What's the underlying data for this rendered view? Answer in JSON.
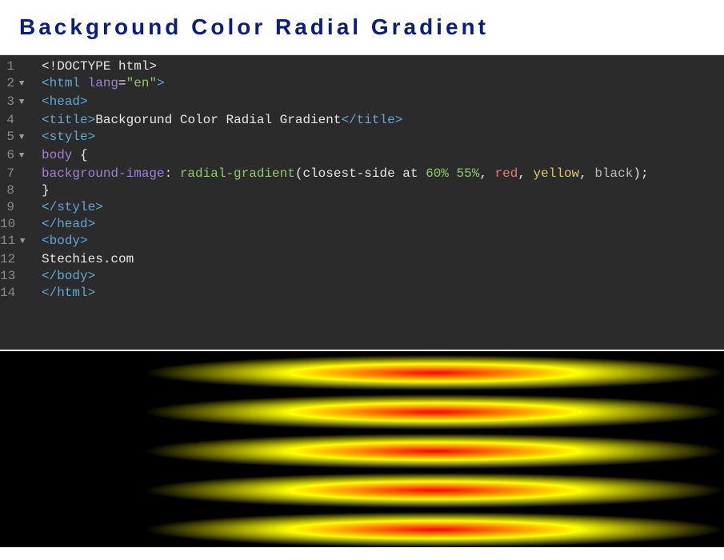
{
  "header": {
    "title": "Background Color Radial Gradient"
  },
  "code": {
    "lines": [
      {
        "n": "1",
        "fold": "",
        "segments": [
          {
            "cls": "t-default",
            "text": "<!DOCTYPE html>"
          }
        ]
      },
      {
        "n": "2",
        "fold": "▼",
        "segments": [
          {
            "cls": "t-angle",
            "text": "<"
          },
          {
            "cls": "t-tag",
            "text": "html"
          },
          {
            "cls": "t-default",
            "text": " "
          },
          {
            "cls": "t-attrname",
            "text": "lang"
          },
          {
            "cls": "t-eq",
            "text": "="
          },
          {
            "cls": "t-string",
            "text": "\"en\""
          },
          {
            "cls": "t-angle",
            "text": ">"
          }
        ]
      },
      {
        "n": "3",
        "fold": "▼",
        "segments": [
          {
            "cls": "t-angle",
            "text": "<"
          },
          {
            "cls": "t-tag",
            "text": "head"
          },
          {
            "cls": "t-angle",
            "text": ">"
          }
        ]
      },
      {
        "n": "4",
        "fold": "",
        "segments": [
          {
            "cls": "t-angle",
            "text": "<"
          },
          {
            "cls": "t-tag",
            "text": "title"
          },
          {
            "cls": "t-angle",
            "text": ">"
          },
          {
            "cls": "t-default",
            "text": "Backgorund Color Radial Gradient"
          },
          {
            "cls": "t-angle",
            "text": "</"
          },
          {
            "cls": "t-tag",
            "text": "title"
          },
          {
            "cls": "t-angle",
            "text": ">"
          }
        ]
      },
      {
        "n": "5",
        "fold": "▼",
        "segments": [
          {
            "cls": "t-angle",
            "text": "<"
          },
          {
            "cls": "t-tag",
            "text": "style"
          },
          {
            "cls": "t-angle",
            "text": ">"
          }
        ]
      },
      {
        "n": "6",
        "fold": "▼",
        "segments": [
          {
            "cls": "t-attrname",
            "text": "body"
          },
          {
            "cls": "t-default",
            "text": " "
          },
          {
            "cls": "t-brace",
            "text": "{"
          }
        ]
      },
      {
        "n": "7",
        "fold": "",
        "segments": [
          {
            "cls": "t-prop",
            "text": "background-image"
          },
          {
            "cls": "t-colon",
            "text": ": "
          },
          {
            "cls": "t-func",
            "text": "radial-gradient"
          },
          {
            "cls": "t-paren",
            "text": "("
          },
          {
            "cls": "t-ident",
            "text": "closest-side at "
          },
          {
            "cls": "t-num",
            "text": "60% 55%"
          },
          {
            "cls": "t-default",
            "text": ", "
          },
          {
            "cls": "t-kw-red",
            "text": "red"
          },
          {
            "cls": "t-default",
            "text": ", "
          },
          {
            "cls": "t-kw-yellow",
            "text": "yellow"
          },
          {
            "cls": "t-default",
            "text": ", "
          },
          {
            "cls": "t-kw-black",
            "text": "black"
          },
          {
            "cls": "t-paren",
            "text": ")"
          },
          {
            "cls": "t-default",
            "text": ";"
          }
        ]
      },
      {
        "n": "8",
        "fold": "",
        "segments": [
          {
            "cls": "t-brace",
            "text": "}"
          }
        ]
      },
      {
        "n": "9",
        "fold": "",
        "segments": [
          {
            "cls": "t-angle",
            "text": "</"
          },
          {
            "cls": "t-tag",
            "text": "style"
          },
          {
            "cls": "t-angle",
            "text": ">"
          }
        ]
      },
      {
        "n": "10",
        "fold": "",
        "segments": [
          {
            "cls": "t-angle",
            "text": "</"
          },
          {
            "cls": "t-tag",
            "text": "head"
          },
          {
            "cls": "t-angle",
            "text": ">"
          }
        ]
      },
      {
        "n": "11",
        "fold": "▼",
        "segments": [
          {
            "cls": "t-angle",
            "text": "<"
          },
          {
            "cls": "t-tag",
            "text": "body"
          },
          {
            "cls": "t-angle",
            "text": ">"
          }
        ]
      },
      {
        "n": "12",
        "fold": "",
        "segments": [
          {
            "cls": "t-default",
            "text": "Stechies.com"
          }
        ]
      },
      {
        "n": "13",
        "fold": "",
        "segments": [
          {
            "cls": "t-angle",
            "text": "</"
          },
          {
            "cls": "t-tag",
            "text": "body"
          },
          {
            "cls": "t-angle",
            "text": ">"
          }
        ]
      },
      {
        "n": "14",
        "fold": "",
        "segments": [
          {
            "cls": "t-angle",
            "text": "</"
          },
          {
            "cls": "t-tag",
            "text": "html"
          },
          {
            "cls": "t-angle",
            "text": ">"
          }
        ]
      }
    ]
  },
  "preview": {
    "gradient_css": "radial-gradient(closest-side at 60% 55%, red, yellow, black)",
    "stripe_count": 5
  }
}
